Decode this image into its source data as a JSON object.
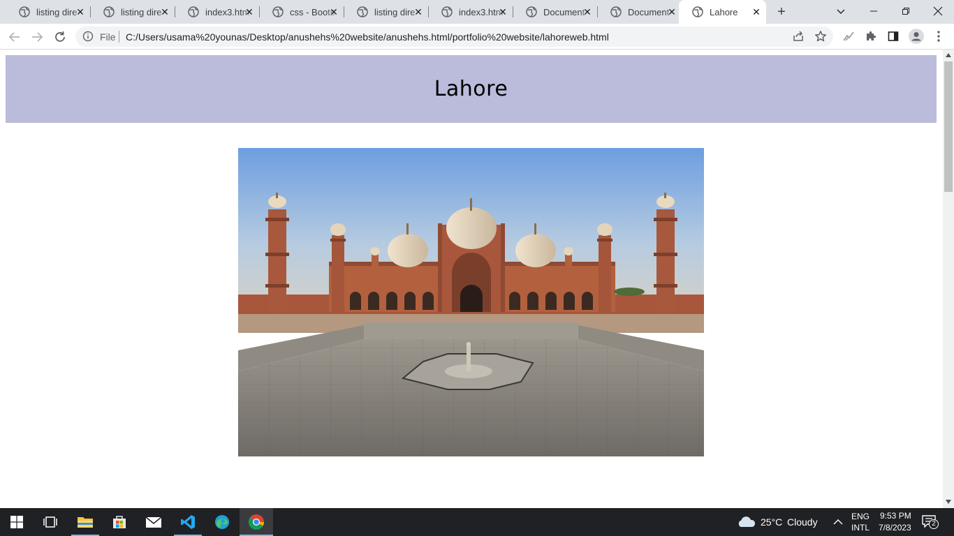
{
  "browser": {
    "tabs": [
      {
        "title": "listing dire",
        "active": false
      },
      {
        "title": "listing dire",
        "active": false
      },
      {
        "title": "index3.htm",
        "active": false
      },
      {
        "title": "css - Boots",
        "active": false
      },
      {
        "title": "listing dire",
        "active": false
      },
      {
        "title": "index3.htm",
        "active": false
      },
      {
        "title": "Document",
        "active": false
      },
      {
        "title": "Document",
        "active": false
      },
      {
        "title": "Lahore",
        "active": true
      }
    ],
    "close_glyph": "✕",
    "new_tab": "+",
    "omnibox": {
      "scheme_label": "File",
      "url": "C:/Users/usama%20younas/Desktop/anushehs%20website/anushehs.html/portfolio%20website/lahoreweb.html"
    }
  },
  "page": {
    "heading": "Lahore",
    "banner_color": "#bbbbdb",
    "image_subject": "Badshahi Mosque, Lahore"
  },
  "taskbar": {
    "weather": {
      "temp": "25°C",
      "condition": "Cloudy"
    },
    "language": {
      "line1": "ENG",
      "line2": "INTL"
    },
    "clock": {
      "time": "9:53 PM",
      "date": "7/8/2023"
    },
    "notifications_count": "2"
  }
}
